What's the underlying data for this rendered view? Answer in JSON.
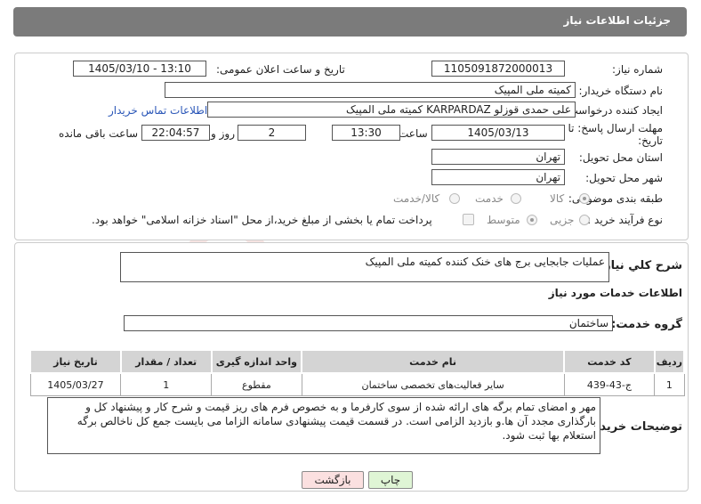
{
  "header": {
    "title": "جزئیات اطلاعات نیاز"
  },
  "fields": {
    "need_number_label": "شماره نیاز:",
    "need_number": "1105091872000013",
    "announce_label": "تاریخ و ساعت اعلان عمومی:",
    "announce_value": "1405/03/10 - 13:10",
    "buyer_org_label": "نام دستگاه خریدار:",
    "buyer_org": "کمیته ملی المپیک",
    "creator_label": "ایجاد کننده درخواست:",
    "creator": "علی حمدی قوزلو KARPARDAZ کمیته ملی المپیک",
    "contact_link": "اطلاعات تماس خریدار",
    "deadline_label_line1": "مهلت ارسال پاسخ: تا",
    "deadline_label_line2": "تاریخ:",
    "deadline_date": "1405/03/13",
    "time_label": "ساعت",
    "deadline_time": "13:30",
    "days_value": "2",
    "days_label": "روز و",
    "remaining_time": "22:04:57",
    "remaining_label": "ساعت باقی مانده",
    "province_label": "استان محل تحویل:",
    "province": "تهران",
    "city_label": "شهر محل تحویل:",
    "city": "تهران",
    "category_label": "طبقه بندی موضوعی:",
    "category_options": [
      "کالا",
      "خدمت",
      "کالا/خدمت"
    ],
    "process_label": "نوع فرآیند خرید :",
    "process_options": [
      "جزیی",
      "متوسط"
    ],
    "payment_note": "پرداخت تمام یا بخشی از مبلغ خرید،از محل \"اسناد خزانه اسلامی\" خواهد بود."
  },
  "summary": {
    "label": "شرح کلي نياز:",
    "value": "عملیات جابجایی برج های خنک کننده کمیته ملی المپیک"
  },
  "services": {
    "section_title": "اطلاعات خدمات مورد نیاز",
    "group_label": "گروه خدمت:",
    "group_value": "ساختمان",
    "columns": [
      "ردیف",
      "کد خدمت",
      "نام خدمت",
      "واحد اندازه گیری",
      "تعداد / مقدار",
      "تاریخ نیاز"
    ],
    "rows": [
      [
        "1",
        "ج-43-439",
        "سایر فعالیت‌های تخصصی ساختمان",
        "مقطوع",
        "1",
        "1405/03/27"
      ]
    ]
  },
  "notes": {
    "label": "توضیحات خریدار:",
    "value": "مهر و امضای تمام برگه های ارائه شده از سوی کارفرما و به خصوص فرم های ریز قیمت و شرح کار و پیشنهاد کل و بارگذاری مجدد آن ها.و بازدید الزامی است. در قسمت قیمت پیشنهادی سامانه الزاما می بایست جمع کل ناخالص برگه استعلام بها ثبت شود."
  },
  "buttons": {
    "print": "چاپ",
    "back": "بازگشت"
  },
  "watermark_text": "AriaTender.neT",
  "colors": {
    "header_bg": "#7b7b7b",
    "print_bg": "#dff5d5",
    "back_bg": "#fbe0e0",
    "table_header_bg": "#d4d4d4",
    "watermark": "#c0392b"
  }
}
